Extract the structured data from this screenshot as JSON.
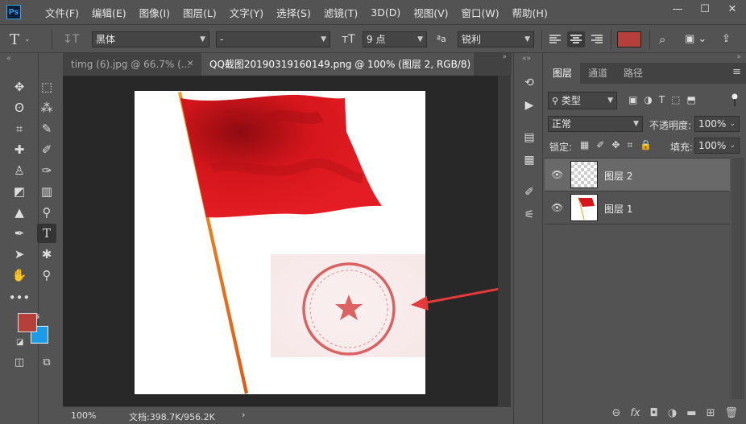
{
  "app": {
    "logo": "Ps"
  },
  "menu": [
    "文件(F)",
    "编辑(E)",
    "图像(I)",
    "图层(L)",
    "文字(Y)",
    "选择(S)",
    "滤镜(T)",
    "3D(D)",
    "视图(V)",
    "窗口(W)",
    "帮助(H)"
  ],
  "window_controls": {
    "minimize": "—",
    "maximize": "☐",
    "close": "✕"
  },
  "options": {
    "font_family": "黑体",
    "font_style": "-",
    "font_size": "9 点",
    "aa_label": "ªa",
    "antialias": "锐利",
    "text_color": "#b5403a"
  },
  "tabs": [
    {
      "label": "timg (6).jpg @ 66.7% (...",
      "close": "✕"
    },
    {
      "label": "QQ截图20190319160149.png @ 100% (图层 2, RGB/8) *",
      "close": "✕"
    }
  ],
  "status": {
    "zoom": "100%",
    "doc": "文档:398.7K/956.2K",
    "arrow": "›"
  },
  "panel": {
    "tabs": [
      "图层",
      "通道",
      "路径"
    ],
    "filter_label": "类型",
    "blend_mode": "正常",
    "opacity_label": "不透明度:",
    "opacity_value": "100%",
    "lock_label": "锁定:",
    "fill_label": "填充:",
    "fill_value": "100%",
    "layers": [
      {
        "name": "图层 2",
        "selected": true
      },
      {
        "name": "图层 1",
        "selected": false
      }
    ],
    "footer": [
      "⊖",
      "fx",
      "◘",
      "◑",
      "▬",
      "⊞",
      "🗑"
    ]
  },
  "colors": {
    "foreground": "#b5403a",
    "background": "#1e9be8",
    "flag_red": "#d9161c",
    "stamp_red": "#d84a4a"
  }
}
